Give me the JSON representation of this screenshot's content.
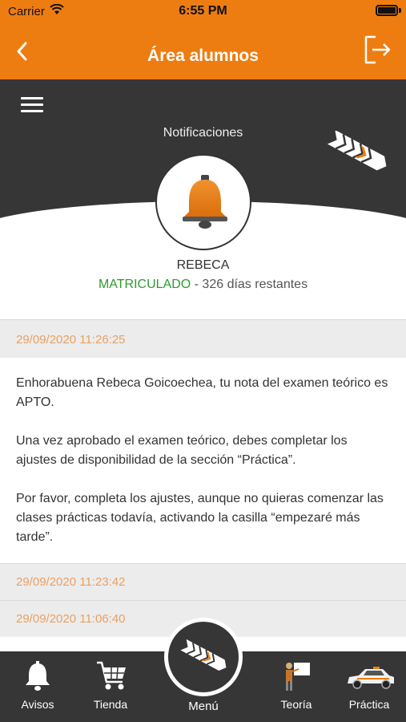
{
  "status_bar": {
    "carrier": "Carrier",
    "time": "6:55 PM"
  },
  "nav": {
    "title": "Área alumnos",
    "back_icon": "chevron-left-icon",
    "logout_icon": "logout-icon"
  },
  "hero": {
    "section_title": "Notificaciones"
  },
  "user": {
    "name": "REBECA",
    "status": "MATRICULADO",
    "remaining": " - 326 días restantes"
  },
  "notifications": [
    {
      "date": "29/09/2020 11:26:25",
      "paragraphs": [
        "Enhorabuena Rebeca Goicoechea, tu nota del examen teórico es APTO.",
        "Una vez aprobado el examen teórico, debes completar los ajustes de disponibilidad de la sección “Práctica”.",
        "Por favor, completa los ajustes, aunque no quieras comenzar las clases prácticas todavía, activando la casilla “empezaré más tarde”."
      ]
    },
    {
      "date": "29/09/2020 11:23:42"
    },
    {
      "date": "29/09/2020 11:06:40"
    }
  ],
  "tabbar": {
    "avisos": "Avisos",
    "tienda": "Tienda",
    "menu": "Menú",
    "teoria": "Teoría",
    "practica": "Práctica"
  },
  "colors": {
    "accent": "#ee7d11",
    "dark": "#363636",
    "date": "#e9a062",
    "enrolled": "#2e9b2e"
  }
}
